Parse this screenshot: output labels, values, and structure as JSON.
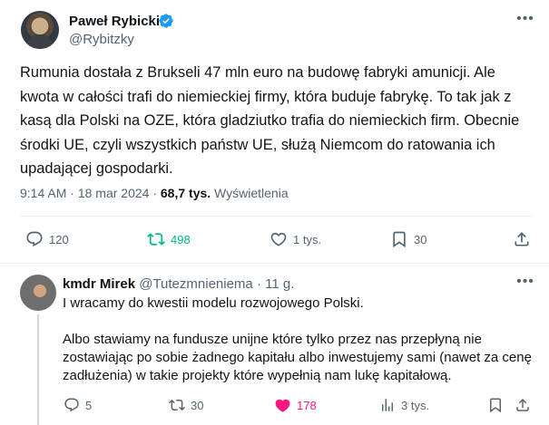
{
  "tweet": {
    "author_name": "Paweł Rybicki",
    "author_handle": "@Rybitzky",
    "text": "Rumunia dostała z Brukseli 47 mln euro na budowę fabryki amunicji. Ale kwota w całości trafi do niemieckiej firmy, która buduje fabrykę. To tak jak z kasą dla Polski na OZE, która gladziutko trafia do niemieckich firm. Obecnie środki UE, czyli wszystkich państw UE, służą Niemcom do ratowania ich upadającej gospodarki.",
    "time": "9:14 AM",
    "date": "18 mar 2024",
    "separator": "·",
    "views_count": "68,7 tys.",
    "views_label": "Wyświetlenia",
    "actions": {
      "replies": "120",
      "retweets": "498",
      "likes": "1 tys.",
      "bookmarks": "30"
    },
    "colors": {
      "verified": "#1d9bf0",
      "retweet_active": "#00ba7c"
    }
  },
  "reply": {
    "author_name": "kmdr Mirek",
    "author_handle": "@Tutezmnieniema",
    "time_ago": "· 11 g.",
    "paragraph1": "I wracamy do kwestii modelu rozwojowego Polski.",
    "paragraph2": "Albo stawiamy na fundusze unijne które tylko przez nas przepłyną nie zostawiając po sobie żadnego kapitału albo inwestujemy sami (nawet za cenę zadłużenia) w takie projekty które wypełnią nam lukę kapitałową.",
    "actions": {
      "replies": "5",
      "retweets": "30",
      "likes": "178",
      "views": "3 tys."
    },
    "colors": {
      "like_active": "#f91880"
    }
  },
  "icons": [
    "verified-badge-icon",
    "more-icon",
    "reply-icon",
    "retweet-icon",
    "like-icon",
    "bookmark-icon",
    "share-icon",
    "views-icon"
  ]
}
